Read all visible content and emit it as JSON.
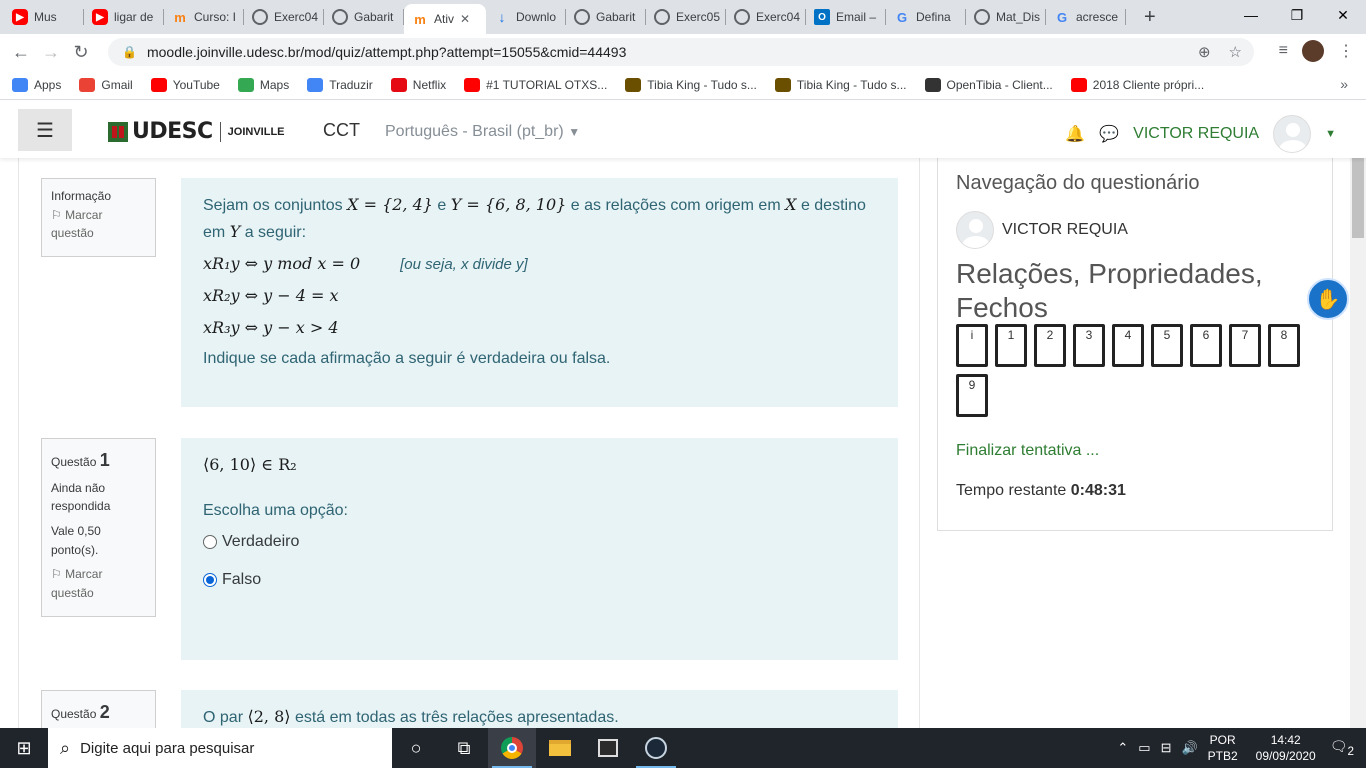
{
  "browser": {
    "tabs": [
      {
        "title": "Mus",
        "icon": "youtube-icon",
        "type": "yt"
      },
      {
        "title": "ligar de",
        "icon": "youtube-icon",
        "type": "yt"
      },
      {
        "title": "Curso: I",
        "icon": "moodle-icon",
        "type": "moodle"
      },
      {
        "title": "Exerc04",
        "icon": "globe-icon",
        "type": "globe"
      },
      {
        "title": "Gabarit",
        "icon": "globe-icon",
        "type": "globe"
      },
      {
        "title": "Ativ",
        "icon": "moodle-icon",
        "type": "moodle",
        "active": true
      },
      {
        "title": "Downlo",
        "icon": "download-icon",
        "type": "dl"
      },
      {
        "title": "Gabarit",
        "icon": "globe-icon",
        "type": "globe"
      },
      {
        "title": "Exerc05",
        "icon": "globe-icon",
        "type": "globe"
      },
      {
        "title": "Exerc04",
        "icon": "globe-icon",
        "type": "globe"
      },
      {
        "title": "Email –",
        "icon": "outlook-icon",
        "type": "ol"
      },
      {
        "title": "Defina",
        "icon": "google-icon",
        "type": "g"
      },
      {
        "title": "Mat_Dis",
        "icon": "globe-icon",
        "type": "globe"
      },
      {
        "title": "acresce",
        "icon": "google-icon",
        "type": "g"
      }
    ],
    "url": "moodle.joinville.udesc.br/mod/quiz/attempt.php?attempt=15055&cmid=44493",
    "bookmarks": [
      {
        "label": "Apps",
        "color": "#4285f4"
      },
      {
        "label": "Gmail",
        "color": "#ea4335"
      },
      {
        "label": "YouTube",
        "color": "#ff0000"
      },
      {
        "label": "Maps",
        "color": "#34a853"
      },
      {
        "label": "Traduzir",
        "color": "#4285f4"
      },
      {
        "label": "Netflix",
        "color": "#e50914"
      },
      {
        "label": "#1 TUTORIAL OTXS...",
        "color": "#ff0000"
      },
      {
        "label": "Tibia King - Tudo s...",
        "color": "#6b4f00"
      },
      {
        "label": "Tibia King - Tudo s...",
        "color": "#6b4f00"
      },
      {
        "label": "OpenTibia - Client...",
        "color": "#333333"
      },
      {
        "label": "2018 Cliente própri...",
        "color": "#ff0000"
      }
    ]
  },
  "moodle": {
    "site": "CCT",
    "logo_text": "UDESC",
    "logo_sub": "JOINVILLE",
    "language": "Português - Brasil (pt_br)",
    "user": "VICTOR REQUIA",
    "info_block": {
      "label": "Informação",
      "flag": "Marcar questão",
      "intro_a": "Sejam os conjuntos",
      "set_x": "X = {2, 4}",
      "intro_and": "e",
      "set_y": "Y = {6, 8, 10}",
      "intro_b": "e as relações com origem em",
      "var_x": "X",
      "intro_c": "e destino em",
      "var_y": "Y",
      "intro_d": "a seguir:",
      "r1": "xR₁y ⇔ y mod x = 0",
      "r1_note": "[ou seja, x divide y]",
      "r2": "xR₂y ⇔ y − 4 = x",
      "r3": "xR₃y ⇔ y − x > 4",
      "instruction": "Indique se cada afirmação a seguir é verdadeira ou falsa."
    },
    "question1": {
      "label": "Questão",
      "number": "1",
      "status": "Ainda não respondida",
      "grade": "Vale 0,50 ponto(s).",
      "flag": "Marcar questão",
      "statement": "⟨6, 10⟩ ∈ R₂",
      "prompt": "Escolha uma opção:",
      "options": [
        {
          "label": "Verdadeiro",
          "selected": false
        },
        {
          "label": "Falso",
          "selected": true
        }
      ]
    },
    "question2": {
      "label": "Questão",
      "number": "2",
      "text_a": "O par",
      "pair": "⟨2, 8⟩",
      "text_b": "está em todas as três relações apresentadas."
    },
    "sidebar": {
      "title": "Navegação do questionário",
      "user": "VICTOR REQUIA",
      "quiz_title": "Relações, Propriedades, Fechos",
      "nav_buttons": [
        "i",
        "1",
        "2",
        "3",
        "4",
        "5",
        "6",
        "7",
        "8",
        "9"
      ],
      "finish": "Finalizar tentativa ...",
      "timer_label": "Tempo restante",
      "timer_value": "0:48:31"
    }
  },
  "taskbar": {
    "search_placeholder": "Digite aqui para pesquisar",
    "lang_top": "POR",
    "lang_bottom": "PTB2",
    "time": "14:42",
    "date": "09/09/2020",
    "notifications": "2"
  }
}
